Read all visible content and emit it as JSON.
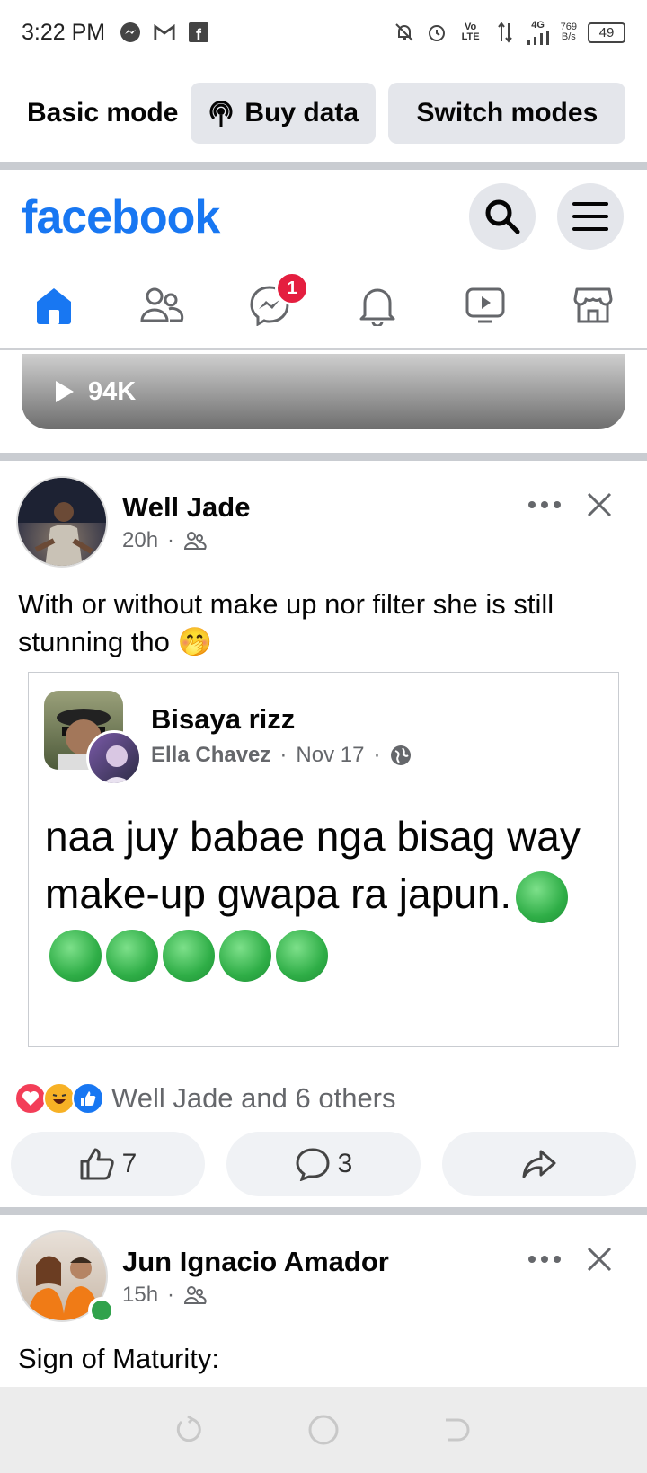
{
  "status_bar": {
    "time": "3:22 PM",
    "network": "Vo LTE",
    "signal": "4G",
    "speed_value": "769",
    "speed_unit": "B/s",
    "battery": "49"
  },
  "mode_bar": {
    "label": "Basic mode",
    "buy_data": "Buy data",
    "switch_modes": "Switch modes"
  },
  "header": {
    "logo": "facebook",
    "messenger_badge": "1"
  },
  "video_remnant": {
    "views": "94K"
  },
  "posts": [
    {
      "author": "Well Jade",
      "time": "20h",
      "audience_icon": "friends-icon",
      "text": "With or without make up nor filter  she is still stunning tho 🤭",
      "shared": {
        "group": "Bisaya rizz",
        "author": "Ella Chavez",
        "date": "Nov 17",
        "text": "naa juy babae nga bisag way make-up gwapa ra japun."
      },
      "reactions_text": "Well Jade and 6 others",
      "like_count": "7",
      "comment_count": "3"
    },
    {
      "author": "Jun Ignacio Amador",
      "time": "15h",
      "text": "Sign of Maturity:"
    }
  ],
  "colors": {
    "brand": "#1877f2",
    "badge": "#e41e3f",
    "separator": "#c9ccd1"
  }
}
